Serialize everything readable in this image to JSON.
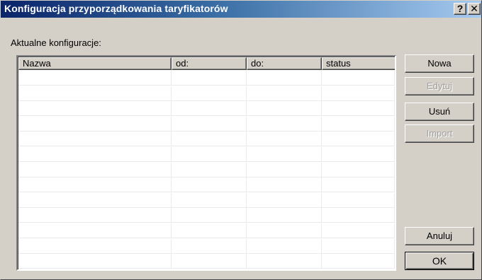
{
  "window": {
    "title": "Konfiguracja przyporządkowania taryfikatorów",
    "help_label": "?",
    "close_label": "✕"
  },
  "section_label": "Aktualne konfiguracje:",
  "table": {
    "columns": [
      "Nazwa",
      "od:",
      "do:",
      "status"
    ],
    "rows": []
  },
  "buttons": {
    "new": {
      "label": "Nowa",
      "enabled": true
    },
    "edit": {
      "label": "Edytuj",
      "enabled": false
    },
    "delete": {
      "label": "Usuń",
      "enabled": true
    },
    "import": {
      "label": "Import",
      "enabled": false
    },
    "cancel": {
      "label": "Anuluj",
      "enabled": true
    },
    "ok": {
      "label": "OK",
      "enabled": true
    }
  },
  "colors": {
    "title_gradient_start": "#0a246a",
    "title_gradient_end": "#a6caf0",
    "dialog_face": "#d4d0c8",
    "disabled_text": "#a0a0a0"
  }
}
